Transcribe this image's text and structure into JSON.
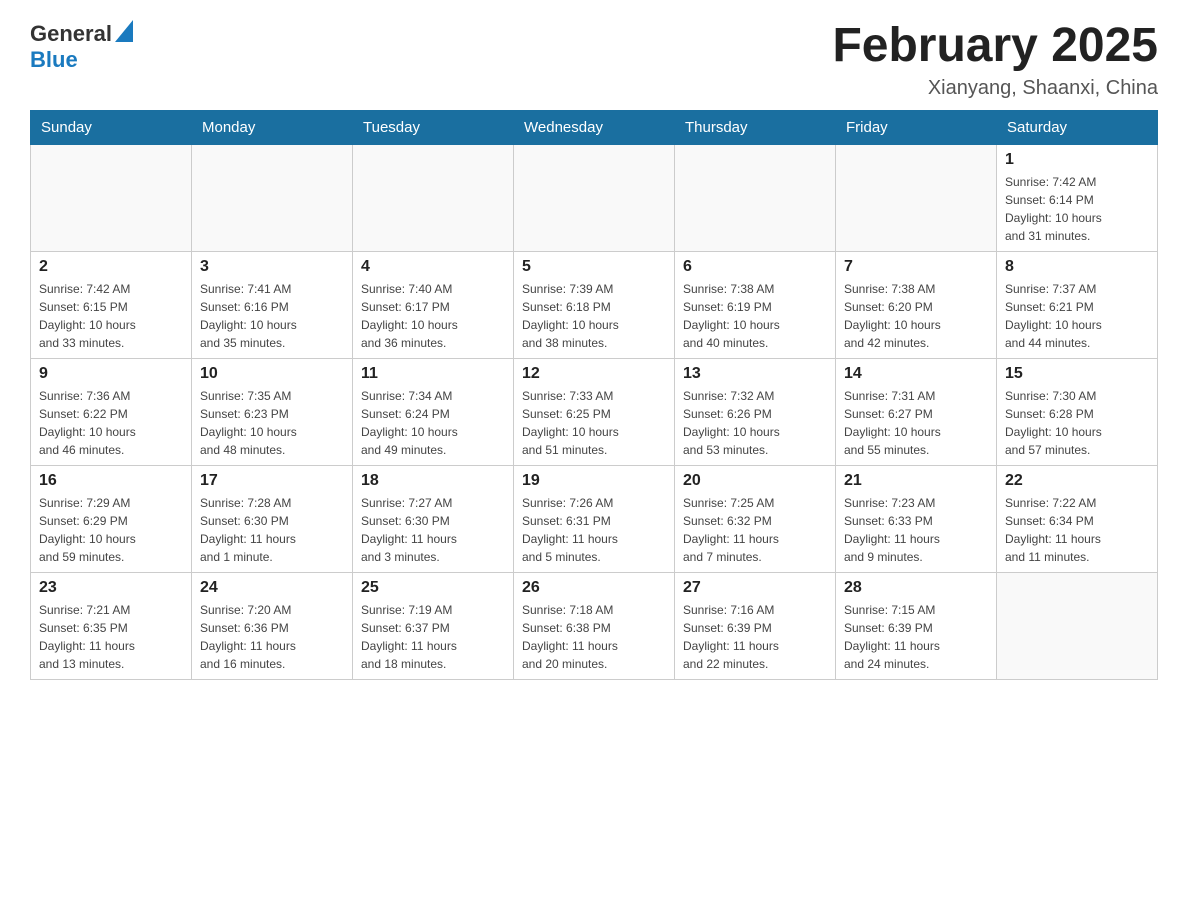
{
  "header": {
    "logo_general": "General",
    "logo_blue": "Blue",
    "title": "February 2025",
    "location": "Xianyang, Shaanxi, China"
  },
  "weekdays": [
    "Sunday",
    "Monday",
    "Tuesday",
    "Wednesday",
    "Thursday",
    "Friday",
    "Saturday"
  ],
  "weeks": [
    [
      {
        "day": "",
        "info": ""
      },
      {
        "day": "",
        "info": ""
      },
      {
        "day": "",
        "info": ""
      },
      {
        "day": "",
        "info": ""
      },
      {
        "day": "",
        "info": ""
      },
      {
        "day": "",
        "info": ""
      },
      {
        "day": "1",
        "info": "Sunrise: 7:42 AM\nSunset: 6:14 PM\nDaylight: 10 hours\nand 31 minutes."
      }
    ],
    [
      {
        "day": "2",
        "info": "Sunrise: 7:42 AM\nSunset: 6:15 PM\nDaylight: 10 hours\nand 33 minutes."
      },
      {
        "day": "3",
        "info": "Sunrise: 7:41 AM\nSunset: 6:16 PM\nDaylight: 10 hours\nand 35 minutes."
      },
      {
        "day": "4",
        "info": "Sunrise: 7:40 AM\nSunset: 6:17 PM\nDaylight: 10 hours\nand 36 minutes."
      },
      {
        "day": "5",
        "info": "Sunrise: 7:39 AM\nSunset: 6:18 PM\nDaylight: 10 hours\nand 38 minutes."
      },
      {
        "day": "6",
        "info": "Sunrise: 7:38 AM\nSunset: 6:19 PM\nDaylight: 10 hours\nand 40 minutes."
      },
      {
        "day": "7",
        "info": "Sunrise: 7:38 AM\nSunset: 6:20 PM\nDaylight: 10 hours\nand 42 minutes."
      },
      {
        "day": "8",
        "info": "Sunrise: 7:37 AM\nSunset: 6:21 PM\nDaylight: 10 hours\nand 44 minutes."
      }
    ],
    [
      {
        "day": "9",
        "info": "Sunrise: 7:36 AM\nSunset: 6:22 PM\nDaylight: 10 hours\nand 46 minutes."
      },
      {
        "day": "10",
        "info": "Sunrise: 7:35 AM\nSunset: 6:23 PM\nDaylight: 10 hours\nand 48 minutes."
      },
      {
        "day": "11",
        "info": "Sunrise: 7:34 AM\nSunset: 6:24 PM\nDaylight: 10 hours\nand 49 minutes."
      },
      {
        "day": "12",
        "info": "Sunrise: 7:33 AM\nSunset: 6:25 PM\nDaylight: 10 hours\nand 51 minutes."
      },
      {
        "day": "13",
        "info": "Sunrise: 7:32 AM\nSunset: 6:26 PM\nDaylight: 10 hours\nand 53 minutes."
      },
      {
        "day": "14",
        "info": "Sunrise: 7:31 AM\nSunset: 6:27 PM\nDaylight: 10 hours\nand 55 minutes."
      },
      {
        "day": "15",
        "info": "Sunrise: 7:30 AM\nSunset: 6:28 PM\nDaylight: 10 hours\nand 57 minutes."
      }
    ],
    [
      {
        "day": "16",
        "info": "Sunrise: 7:29 AM\nSunset: 6:29 PM\nDaylight: 10 hours\nand 59 minutes."
      },
      {
        "day": "17",
        "info": "Sunrise: 7:28 AM\nSunset: 6:30 PM\nDaylight: 11 hours\nand 1 minute."
      },
      {
        "day": "18",
        "info": "Sunrise: 7:27 AM\nSunset: 6:30 PM\nDaylight: 11 hours\nand 3 minutes."
      },
      {
        "day": "19",
        "info": "Sunrise: 7:26 AM\nSunset: 6:31 PM\nDaylight: 11 hours\nand 5 minutes."
      },
      {
        "day": "20",
        "info": "Sunrise: 7:25 AM\nSunset: 6:32 PM\nDaylight: 11 hours\nand 7 minutes."
      },
      {
        "day": "21",
        "info": "Sunrise: 7:23 AM\nSunset: 6:33 PM\nDaylight: 11 hours\nand 9 minutes."
      },
      {
        "day": "22",
        "info": "Sunrise: 7:22 AM\nSunset: 6:34 PM\nDaylight: 11 hours\nand 11 minutes."
      }
    ],
    [
      {
        "day": "23",
        "info": "Sunrise: 7:21 AM\nSunset: 6:35 PM\nDaylight: 11 hours\nand 13 minutes."
      },
      {
        "day": "24",
        "info": "Sunrise: 7:20 AM\nSunset: 6:36 PM\nDaylight: 11 hours\nand 16 minutes."
      },
      {
        "day": "25",
        "info": "Sunrise: 7:19 AM\nSunset: 6:37 PM\nDaylight: 11 hours\nand 18 minutes."
      },
      {
        "day": "26",
        "info": "Sunrise: 7:18 AM\nSunset: 6:38 PM\nDaylight: 11 hours\nand 20 minutes."
      },
      {
        "day": "27",
        "info": "Sunrise: 7:16 AM\nSunset: 6:39 PM\nDaylight: 11 hours\nand 22 minutes."
      },
      {
        "day": "28",
        "info": "Sunrise: 7:15 AM\nSunset: 6:39 PM\nDaylight: 11 hours\nand 24 minutes."
      },
      {
        "day": "",
        "info": ""
      }
    ]
  ]
}
